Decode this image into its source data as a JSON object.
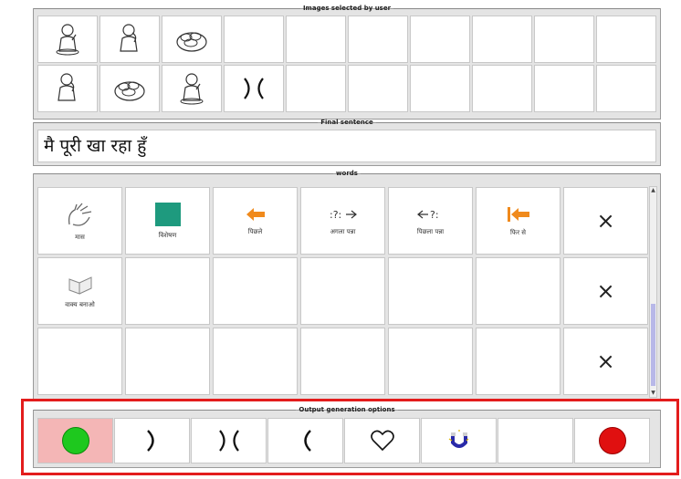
{
  "symbols_panel": {
    "title": "Images selected by user"
  },
  "sentence_panel": {
    "title": "Final sentence",
    "sentence": "मै पूरी खा रहा हुँ"
  },
  "words_panel": {
    "title": "words",
    "rows": [
      [
        {
          "label": "मास",
          "icon": "hand-gesture-icon"
        },
        {
          "label": "विशेषण",
          "icon": "green-square-icon"
        },
        {
          "label": "पिछले",
          "icon": "back-arrow-icon"
        },
        {
          "label": "अगला पन्ना",
          "icon": "next-page-icon"
        },
        {
          "label": "पिछला पन्ना",
          "icon": "previous-page-icon"
        },
        {
          "label": "फिर से",
          "icon": "first-arrow-icon"
        },
        {
          "label": "",
          "icon": "close-icon"
        }
      ],
      [
        {
          "label": "वाक्य बनाओ",
          "icon": "book-icon"
        },
        {
          "label": "",
          "icon": ""
        },
        {
          "label": "",
          "icon": ""
        },
        {
          "label": "",
          "icon": ""
        },
        {
          "label": "",
          "icon": ""
        },
        {
          "label": "",
          "icon": ""
        },
        {
          "label": "",
          "icon": "close-icon"
        }
      ],
      [
        {
          "label": "",
          "icon": ""
        },
        {
          "label": "",
          "icon": ""
        },
        {
          "label": "",
          "icon": ""
        },
        {
          "label": "",
          "icon": ""
        },
        {
          "label": "",
          "icon": ""
        },
        {
          "label": "",
          "icon": ""
        },
        {
          "label": "",
          "icon": "close-icon"
        }
      ]
    ],
    "close_glyph": "×"
  },
  "output_panel": {
    "title": "Output generation options",
    "options": [
      {
        "icon": "green-dot-icon",
        "active": true
      },
      {
        "icon": "right-bracket-icon",
        "glyph": ")"
      },
      {
        "icon": "split-bracket-icon",
        "glyph": ")("
      },
      {
        "icon": "left-bracket-icon",
        "glyph": "("
      },
      {
        "icon": "heart-icon",
        "glyph": "♡"
      },
      {
        "icon": "magnet-icon"
      },
      {
        "icon": "empty-option"
      },
      {
        "icon": "red-dot-icon"
      }
    ]
  },
  "colors": {
    "accent_outline": "#e31c1c",
    "active_option_bg": "#f4b6b6",
    "green_dot": "#1ec81e",
    "red_dot": "#e01010",
    "teal_square": "#1e9a7e",
    "orange_arrow": "#f08a1c"
  }
}
